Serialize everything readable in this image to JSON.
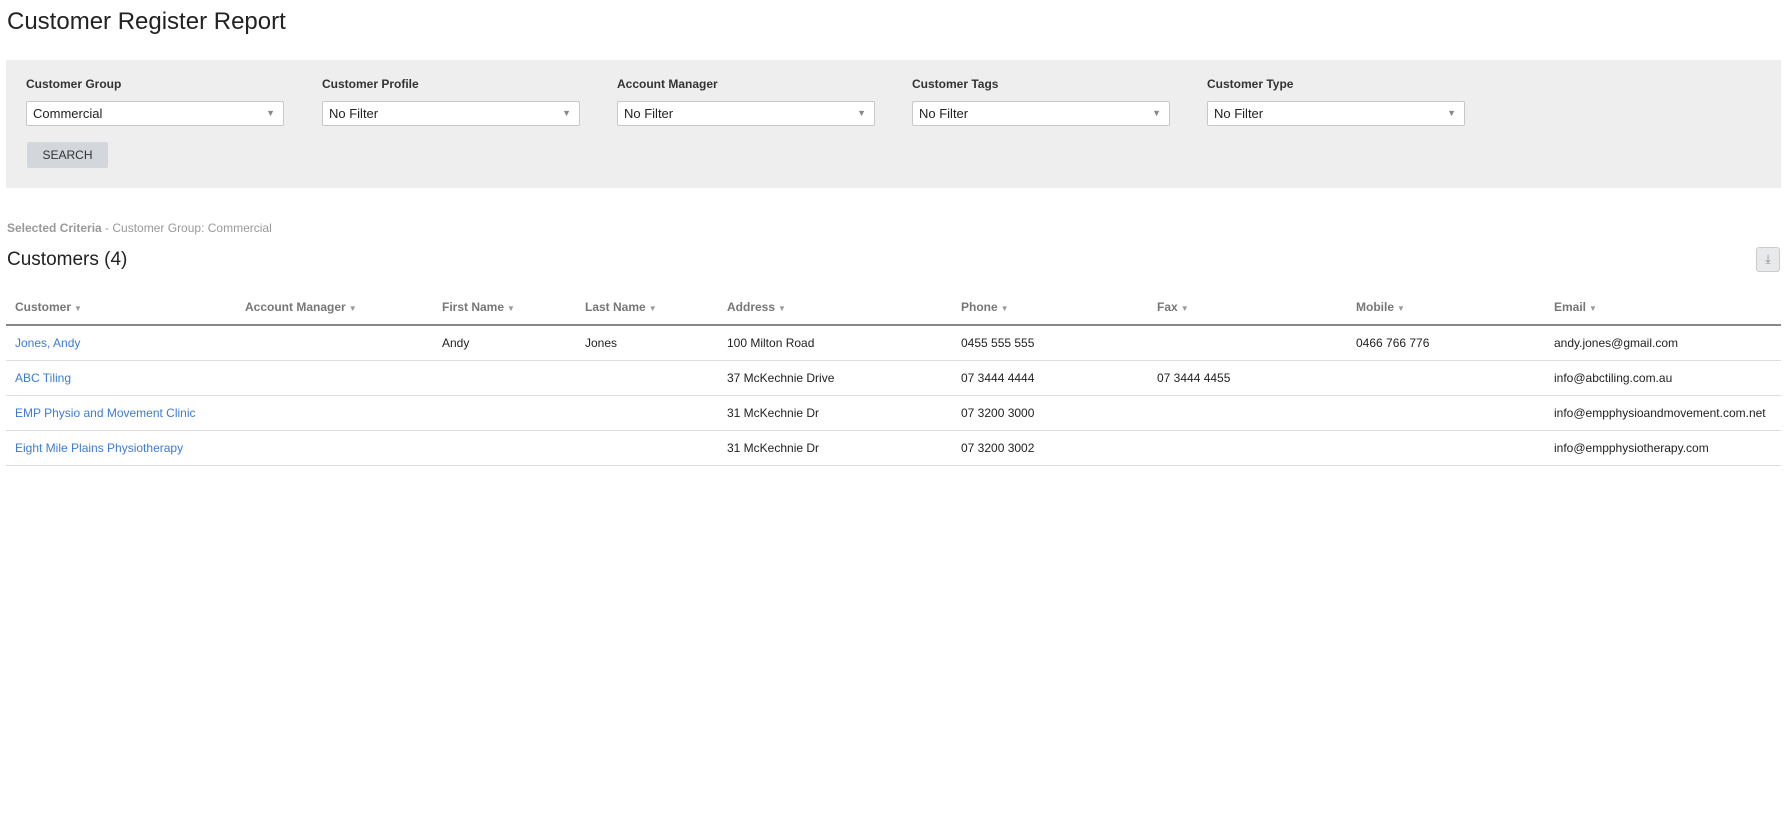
{
  "page_title": "Customer Register Report",
  "filters": [
    {
      "label": "Customer Group",
      "value": "Commercial"
    },
    {
      "label": "Customer Profile",
      "value": "No Filter"
    },
    {
      "label": "Account Manager",
      "value": "No Filter"
    },
    {
      "label": "Customer Tags",
      "value": "No Filter"
    },
    {
      "label": "Customer Type",
      "value": "No Filter"
    }
  ],
  "search_label": "SEARCH",
  "criteria": {
    "label": "Selected Criteria",
    "text": " - Customer Group: Commercial"
  },
  "section_title": "Customers (4)",
  "download_icon": "download-icon",
  "columns": [
    "Customer",
    "Account Manager",
    "First Name",
    "Last Name",
    "Address",
    "Phone",
    "Fax",
    "Mobile",
    "Email"
  ],
  "rows": [
    [
      "Jones, Andy",
      "",
      "Andy",
      "Jones",
      "100 Milton Road",
      "0455 555 555",
      "",
      "0466 766 776",
      "andy.jones@gmail.com"
    ],
    [
      "ABC Tiling",
      "",
      "",
      "",
      "37 McKechnie Drive",
      "07 3444 4444",
      "07 3444 4455",
      "",
      "info@abctiling.com.au"
    ],
    [
      "EMP Physio and Movement Clinic",
      "",
      "",
      "",
      "31 McKechnie Dr",
      "07 3200 3000",
      "",
      "",
      "info@empphysioandmovement.com.net"
    ],
    [
      "Eight Mile Plains Physiotherapy",
      "",
      "",
      "",
      "31 McKechnie Dr",
      "07 3200 3002",
      "",
      "",
      "info@empphysiotherapy.com"
    ]
  ]
}
